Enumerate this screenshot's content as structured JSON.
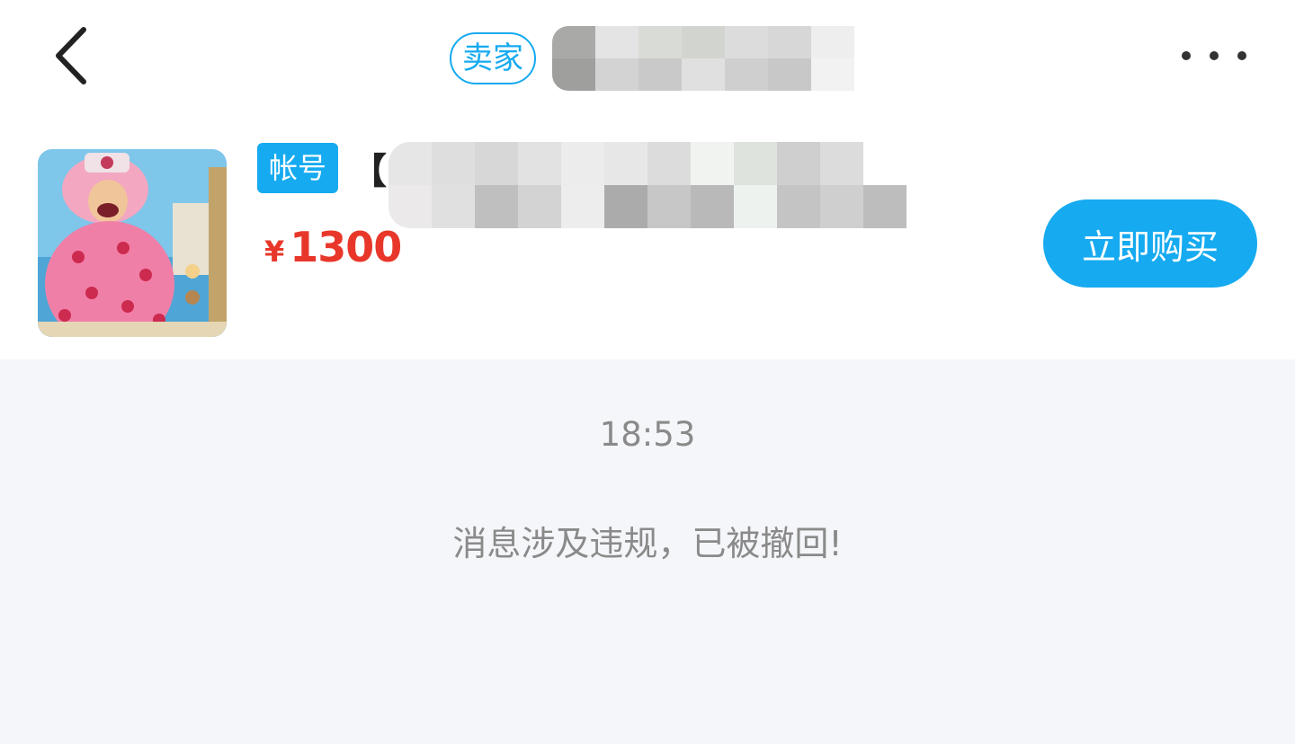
{
  "header": {
    "back_icon": "chevron-left-icon",
    "seller_tag": "卖家",
    "more_icon": "more-dots-icon"
  },
  "product": {
    "thumbnail_icon": "game-character-image",
    "type_tag": "帐号",
    "title_prefix": "【(",
    "currency": "¥",
    "price": "1300",
    "buy_label": "立即购买"
  },
  "chat": {
    "time": "18:53",
    "notice": "消息涉及违规，已被撤回!"
  },
  "colors": {
    "accent": "#16aaf0",
    "price": "#e8372a",
    "chat_bg": "#f5f6f9",
    "muted_text": "#8a8a8a"
  }
}
